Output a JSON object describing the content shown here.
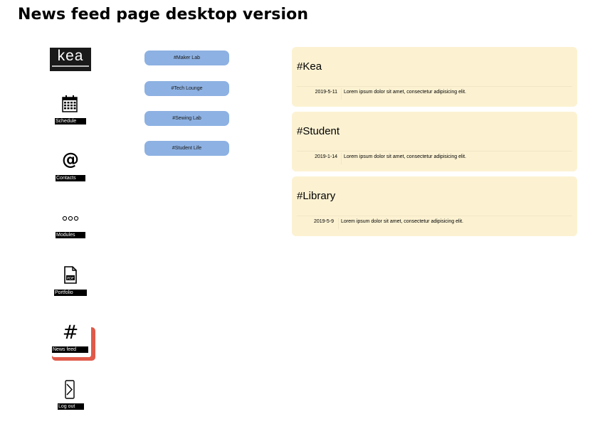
{
  "page": {
    "title": "News feed page desktop version"
  },
  "logo": {
    "text": "kea"
  },
  "sidebar": {
    "items": [
      {
        "label": "Schedule",
        "icon": "calendar-icon"
      },
      {
        "label": "Contacts",
        "icon": "at-icon"
      },
      {
        "label": "Modules",
        "icon": "three-dots-icon"
      },
      {
        "label": "Portfolio",
        "icon": "pdf-file-icon"
      },
      {
        "label": "News feed",
        "icon": "hashtag-icon",
        "active": true
      },
      {
        "label": "Log out",
        "icon": "logout-icon"
      }
    ],
    "active_color": "#e05a4a"
  },
  "tags": [
    {
      "label": "#Maker Lab"
    },
    {
      "label": "#Tech Lounge"
    },
    {
      "label": "#Sewing Lab"
    },
    {
      "label": "#Student Life"
    }
  ],
  "feed": [
    {
      "title": "#Kea",
      "date": "2019-5-11",
      "text": "Lorem ipsum dolor sit amet, consectetur adipisicing elit."
    },
    {
      "title": "#Student",
      "date": "2019-1-14",
      "text": "Lorem ipsum dolor sit amet, consectetur adipisicing elit."
    },
    {
      "title": "#Library",
      "date": "2019-5-9",
      "text": "Lorem ipsum dolor sit amet, consectetur adipisicing elit."
    }
  ],
  "colors": {
    "tag_bg": "#8db1e2",
    "card_bg": "#fcf2d2"
  }
}
